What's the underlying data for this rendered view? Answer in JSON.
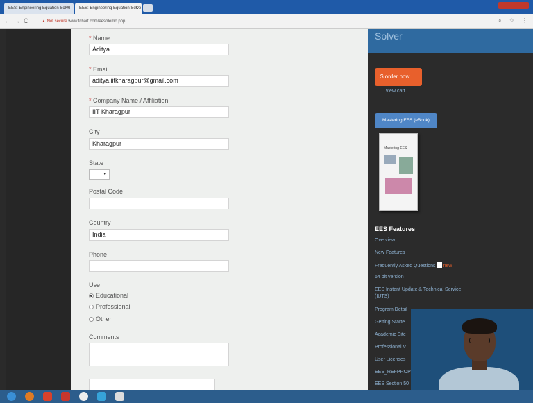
{
  "browser": {
    "tabs": [
      {
        "label": "EES: Engineering Equation Solve"
      },
      {
        "label": "EES: Engineering Equation Solve"
      }
    ],
    "security_label": "Not secure",
    "url": "www.fchart.com/ees/demo.php"
  },
  "header": {
    "title": "Solver"
  },
  "form": {
    "name": {
      "label": "Name",
      "value": "Aditya"
    },
    "email": {
      "label": "Email",
      "value": "aditya.iitkharagpur@gmail.com"
    },
    "company": {
      "label": "Company Name / Affiliation",
      "value": "IIT Kharagpur"
    },
    "city": {
      "label": "City",
      "value": "Kharagpur"
    },
    "state": {
      "label": "State",
      "value": "▾"
    },
    "postal": {
      "label": "Postal Code",
      "value": ""
    },
    "country": {
      "label": "Country",
      "value": "India"
    },
    "phone": {
      "label": "Phone",
      "value": ""
    },
    "use": {
      "label": "Use",
      "options": [
        "Educational",
        "Professional",
        "Other"
      ],
      "selected": "Educational"
    },
    "comments": {
      "label": "Comments",
      "value": ""
    }
  },
  "sidebar": {
    "order_button": "$  order now",
    "view_cart": "view cart",
    "mastering_button": "Mastering EES (eBook)",
    "book_title": "Mastering EES",
    "features_title": "EES Features",
    "features": [
      "Overview",
      "New Features",
      "Frequently Asked Questions",
      "64 bit version",
      "EES Instant Update & Technical Service",
      "(IUTS)",
      "Program Detail",
      "Getting Starte",
      "Academic Site",
      "Professional V",
      "User Licenses",
      "EES_REFPROP I",
      "EES Section 50"
    ],
    "new_badge": "new"
  },
  "colors": {
    "accent_order": "#e8602c",
    "accent_blue": "#4f86c6",
    "link": "#8fb3d3"
  }
}
